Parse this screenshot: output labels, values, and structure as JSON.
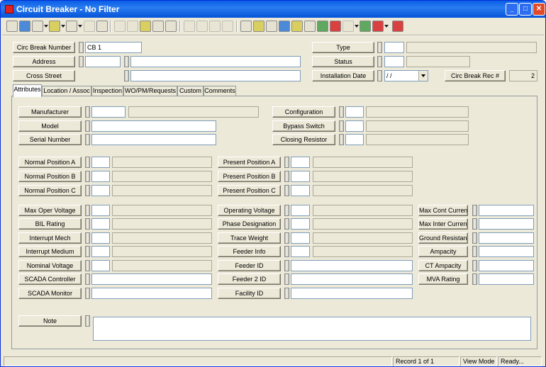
{
  "window": {
    "title": "Circuit Breaker - No Filter",
    "minimize": "_",
    "maximize": "□",
    "close": "✕"
  },
  "toolbar": {
    "icons": [
      "form-icon",
      "search-icon",
      "binoculars-icon",
      "filter-icon",
      "report-icon",
      "copy-icon",
      "save-icon",
      "delete-icon",
      "attach-icon",
      "edit-icon",
      "scissors-icon",
      "first-record-icon",
      "prev-record-icon",
      "next-record-icon",
      "last-record-icon",
      "goto-icon",
      "lightning-icon",
      "map-icon",
      "network-icon",
      "gallery-icon",
      "calc-icon",
      "photo-icon",
      "tool-icon",
      "globe-icon",
      "monitor-icon",
      "book-icon",
      "exit-icon"
    ]
  },
  "header": {
    "circ_break_number": {
      "label": "Circ Break Number",
      "value": "CB 1"
    },
    "address": {
      "label": "Address",
      "value": "",
      "desc": ""
    },
    "cross_street": {
      "label": "Cross Street",
      "value": ""
    },
    "type": {
      "label": "Type",
      "value": "",
      "desc": ""
    },
    "status": {
      "label": "Status",
      "value": "",
      "desc": ""
    },
    "installation_date": {
      "label": "Installation Date",
      "value": " / /"
    },
    "circ_break_rec": {
      "label": "Circ Break Rec #",
      "value": "2"
    }
  },
  "tabs": [
    "Attributes",
    "Location / Assoc",
    "Inspection",
    "WO/PM/Requests",
    "Custom",
    "Comments"
  ],
  "attributes": {
    "manufacturer": "Manufacturer",
    "model": "Model",
    "serial_number": "Serial Number",
    "configuration": "Configuration",
    "bypass_switch": "Bypass Switch",
    "closing_resistor": "Closing Resistor",
    "normal_position_a": "Normal Position A",
    "normal_position_b": "Normal Position B",
    "normal_position_c": "Normal Position C",
    "present_position_a": "Present Position A",
    "present_position_b": "Present Position B",
    "present_position_c": "Present Position C",
    "max_oper_voltage": "Max Oper Voltage",
    "bil_rating": "BIL Rating",
    "interrupt_mech": "Interrupt Mech",
    "interrupt_medium": "Interrupt Medium",
    "nominal_voltage": "Nominal Voltage",
    "scada_controller": "SCADA Controller",
    "scada_monitor": "SCADA Monitor",
    "operating_voltage": "Operating Voltage",
    "phase_designation": "Phase Designation",
    "trace_weight": "Trace Weight",
    "feeder_info": "Feeder Info",
    "feeder_id": "Feeder ID",
    "feeder_2_id": "Feeder 2 ID",
    "facility_id": "Facility ID",
    "max_cont_current": "Max Cont Current",
    "max_inter_current": "Max Inter Current",
    "ground_resistance": "Ground Resistance",
    "ampacity": "Ampacity",
    "ct_ampacity": "CT Ampacity",
    "mva_rating": "MVA Rating",
    "note": "Note"
  },
  "statusbar": {
    "record": "Record 1 of 1",
    "mode": "View Mode",
    "state": "Ready..."
  }
}
